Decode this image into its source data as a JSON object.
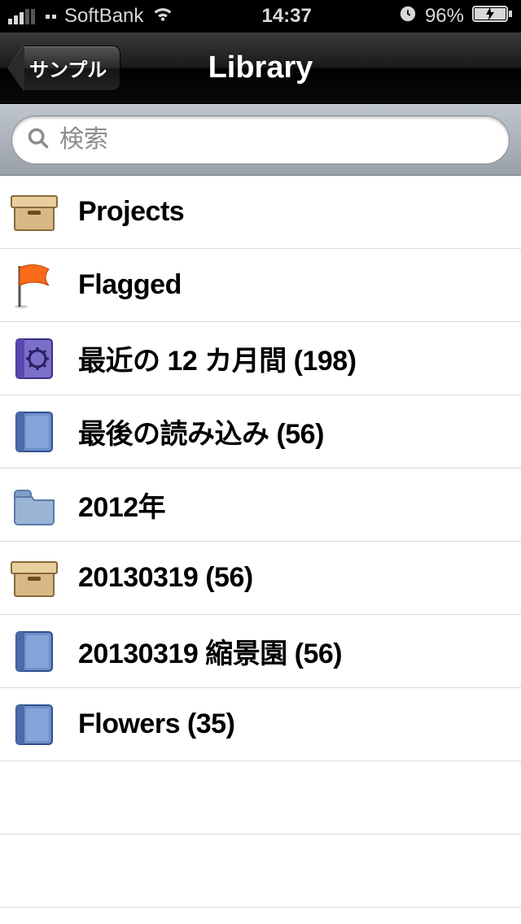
{
  "status_bar": {
    "carrier": "SoftBank",
    "time": "14:37",
    "battery_percent": "96%"
  },
  "nav": {
    "back_label": "サンプル",
    "title": "Library"
  },
  "search": {
    "placeholder": "検索"
  },
  "list": {
    "items": [
      {
        "icon": "box",
        "label": "Projects"
      },
      {
        "icon": "flag",
        "label": "Flagged"
      },
      {
        "icon": "gear-book",
        "label": "最近の 12 カ月間 (198)"
      },
      {
        "icon": "book",
        "label": "最後の読み込み (56)"
      },
      {
        "icon": "folder",
        "label": "2012年"
      },
      {
        "icon": "box",
        "label": "20130319 (56)"
      },
      {
        "icon": "book",
        "label": "20130319 縮景園 (56)"
      },
      {
        "icon": "book",
        "label": "Flowers (35)"
      }
    ]
  }
}
